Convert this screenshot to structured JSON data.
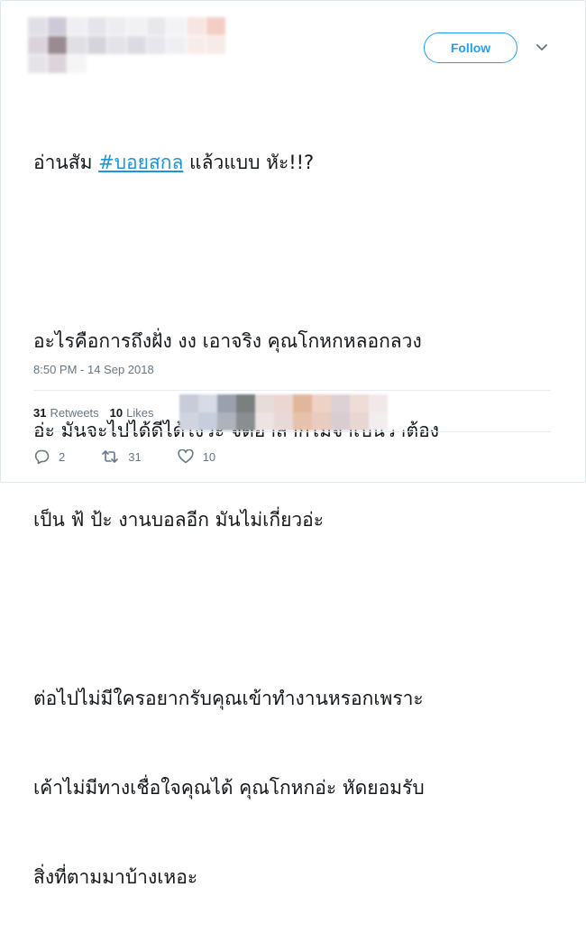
{
  "header": {
    "follow_label": "Follow",
    "chevron_icon": "chevron-down-icon"
  },
  "tweet": {
    "line1_before": "อ่านสัม ",
    "hashtag": "#บอยสกล",
    "line1_after": " แล้วแบบ หัะ!!?",
    "para2": [
      "อะไรคือการถึงฝั่ง งง เอาจริง คุณโกหกหลอกลวง",
      "อ่ะ มันจะไปได้ดีได้ไงว่ะ จิตอาสาก็ไม่จำเป็นว่าต้อง",
      "เป็น ฟ้ ป้ะ งานบอลอีก มันไม่เกี่ยวอ่ะ"
    ],
    "para3": [
      "ต่อไปไม่มีใครอยากรับคุณเข้าทำงานหรอกเพราะ",
      "เค้าไม่มีทางเชื่อใจคุณได้ คุณโกหกอ่ะ หัดยอมรับ",
      "สิ่งที่ตามมาบ้างเหอะ"
    ]
  },
  "timestamp": "8:50 PM - 14 Sep 2018",
  "stats": {
    "retweets_count": "31",
    "retweets_label": "Retweets",
    "likes_count": "10",
    "likes_label": "Likes"
  },
  "actions": {
    "reply_count": "2",
    "retweet_count": "31",
    "like_count": "10"
  },
  "colors": {
    "accent": "#1da1f2",
    "link": "#1b95e0",
    "muted": "#657786"
  }
}
